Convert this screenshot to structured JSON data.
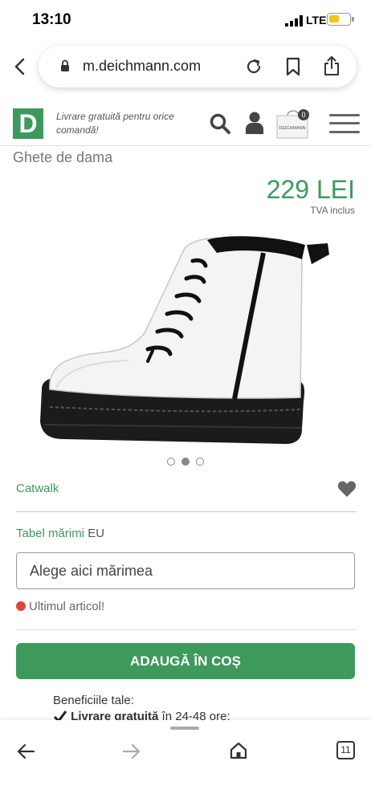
{
  "status_bar": {
    "time": "13:10",
    "network": "LTE"
  },
  "browser": {
    "url": "m.deichmann.com",
    "tab_count": "11"
  },
  "header": {
    "logo_letter": "D",
    "promo_text": "Livrare gratuită pentru orice comandă!",
    "cart_count": "0",
    "cart_bag_label": "DEICHMANN"
  },
  "product": {
    "category": "Ghete de dama",
    "price": "229 LEI",
    "vat_note": "TVA inclus",
    "image_dots": 3,
    "active_dot": 2,
    "brand": "Catwalk",
    "size_table_label": "Tabel mărimi",
    "size_unit": "EU",
    "size_placeholder": "Alege aici mărimea",
    "stock_status": "Ultimul articol!",
    "add_to_cart_label": "ADAUGĂ ÎN COȘ"
  },
  "benefits": {
    "title": "Beneficiile tale:",
    "items": [
      {
        "bold": "Livrare gratuită",
        "rest": " în 24-48 ore;"
      }
    ]
  },
  "colors": {
    "brand_green": "#3d9a5c",
    "stock_red": "#d9483b"
  }
}
